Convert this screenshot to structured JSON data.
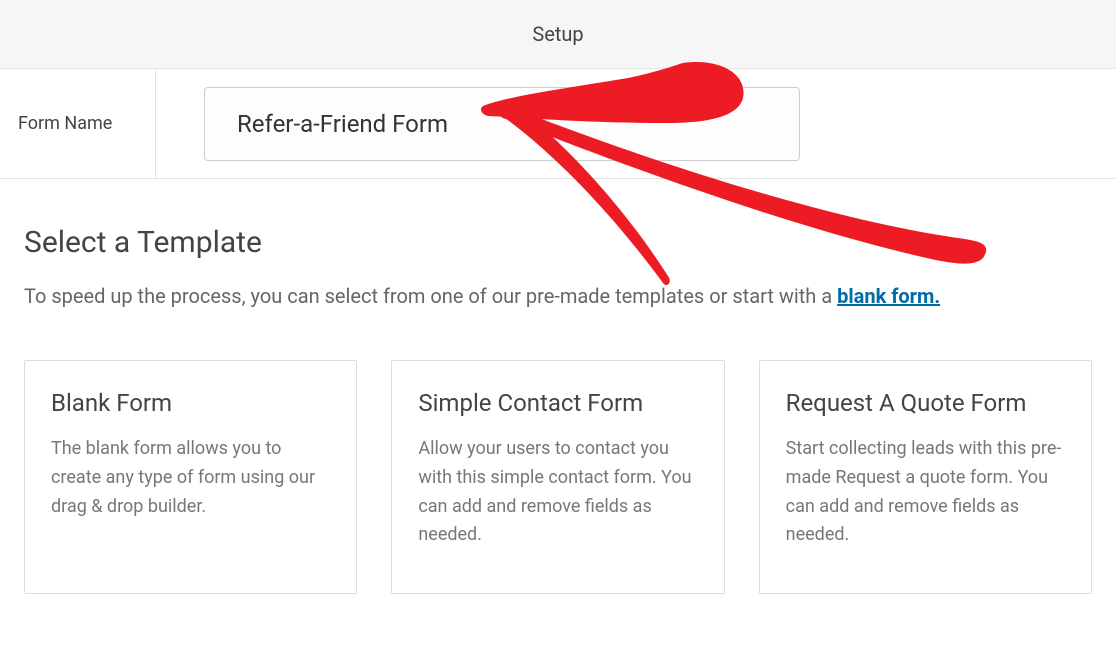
{
  "header": {
    "title": "Setup"
  },
  "form": {
    "name_label": "Form Name",
    "name_value": "Refer-a-Friend Form"
  },
  "section": {
    "title": "Select a Template",
    "desc_prefix": "To speed up the process, you can select from one of our pre-made templates or start with a ",
    "blank_link": "blank form."
  },
  "templates": [
    {
      "title": "Blank Form",
      "desc": "The blank form allows you to create any type of form using our drag & drop builder."
    },
    {
      "title": "Simple Contact Form",
      "desc": "Allow your users to contact you with this simple contact form. You can add and remove fields as needed."
    },
    {
      "title": "Request A Quote Form",
      "desc": "Start collecting leads with this pre-made Request a quote form. You can add and remove fields as needed."
    }
  ]
}
